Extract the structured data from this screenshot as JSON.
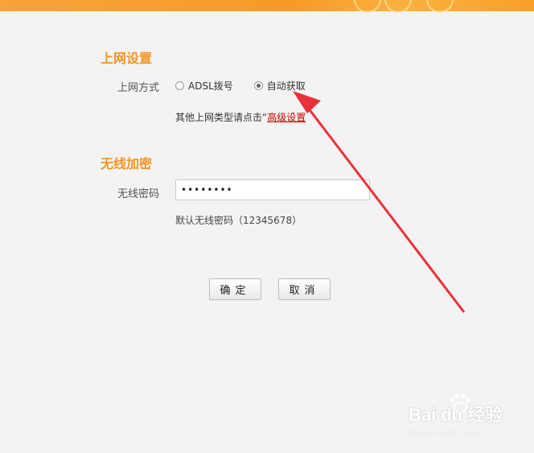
{
  "sections": {
    "internet": {
      "title": "上网设置",
      "connection_label": "上网方式",
      "options": [
        {
          "label": "ADSL拨号",
          "selected": false
        },
        {
          "label": "自动获取",
          "selected": true
        }
      ],
      "hint_prefix": "其他上网类型请点击“",
      "hint_link": "高级设置"
    },
    "wireless": {
      "title": "无线加密",
      "password_label": "无线密码",
      "password_value": "••••••••",
      "default_note": "默认无线密码（12345678）"
    }
  },
  "buttons": {
    "confirm": "确定",
    "cancel": "取消"
  },
  "colors": {
    "accent": "#f39423",
    "link": "#cc0000",
    "arrow": "#e8313a"
  },
  "watermark": {
    "brand": "Bai du 经验",
    "url": "jingyan.baidu.com"
  }
}
